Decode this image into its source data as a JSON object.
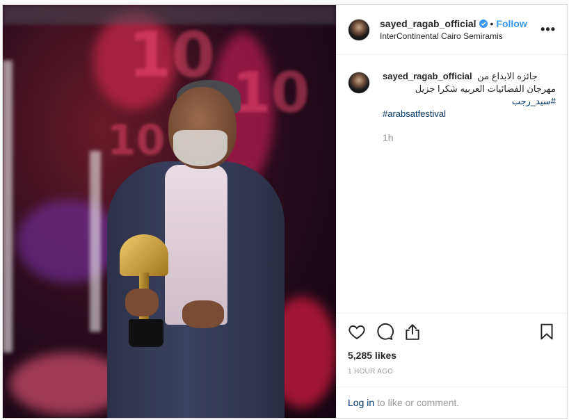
{
  "post": {
    "image_alt": "Man holding trophy on stage",
    "user": {
      "username": "sayed_ragab_official",
      "location": "InterContinental Cairo Semiramis",
      "follow_label": "Follow",
      "separator": "•"
    },
    "more_label": "•••",
    "caption": {
      "username": "sayed_ragab_official",
      "line1": "جائزه الابداع من",
      "line2_text": "مهرجان الفضائيات العربيه شكرا جزيل ",
      "line2_tag": "#سيد_رجب",
      "line3_tag": "#arabsatfestival",
      "time": "1h"
    },
    "likes": "5,285 likes",
    "time_ago": "1 HOUR AGO",
    "login": {
      "link": "Log in",
      "rest": "to like or comment."
    }
  },
  "colors": {
    "accent": "#3897f0",
    "link": "#003569",
    "muted": "#999999"
  },
  "icons": [
    "verified-badge-icon",
    "heart-icon",
    "comment-icon",
    "share-icon",
    "bookmark-icon",
    "more-icon"
  ]
}
